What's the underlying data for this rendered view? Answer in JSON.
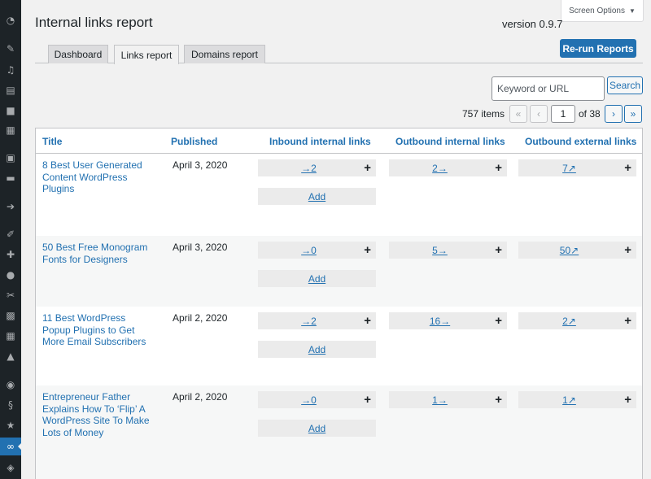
{
  "page": {
    "title": "Internal links report",
    "screen_options": "Screen Options",
    "version_label": "version",
    "version": "0.9.7",
    "rerun_label": "Re-run Reports"
  },
  "tabs": [
    {
      "label": "Dashboard",
      "active": false
    },
    {
      "label": "Links report",
      "active": true
    },
    {
      "label": "Domains report",
      "active": false
    }
  ],
  "search": {
    "placeholder": "Keyword or URL",
    "button": "Search"
  },
  "pagination": {
    "items": "757 items",
    "first": "«",
    "prev": "‹",
    "current": "1",
    "of": "of 38",
    "next": "›",
    "last": "»"
  },
  "table": {
    "columns": [
      "Title",
      "Published",
      "Inbound internal links",
      "Outbound internal links",
      "Outbound external links"
    ],
    "add_label": "Add",
    "plus": "+",
    "rows": [
      {
        "title": "8 Best User Generated Content WordPress Plugins",
        "date": "April 3, 2020",
        "inbound": "→2",
        "outbound_internal": "2→",
        "outbound_external": "7↗"
      },
      {
        "title": "50 Best Free Monogram Fonts for Designers",
        "date": "April 3, 2020",
        "inbound": "→0",
        "outbound_internal": "5→",
        "outbound_external": "50↗"
      },
      {
        "title": "11 Best WordPress Popup Plugins to Get More Email Subscribers",
        "date": "April 2, 2020",
        "inbound": "→2",
        "outbound_internal": "16→",
        "outbound_external": "2↗"
      },
      {
        "title": "Entrepreneur Father Explains How To ‘Flip’ A WordPress Site To Make Lots of Money",
        "date": "April 2, 2020",
        "inbound": "→0",
        "outbound_internal": "1→",
        "outbound_external": "1↗"
      }
    ]
  },
  "sidebar": {
    "icons": [
      "dashboard-icon",
      "pin-icon",
      "media-icon",
      "pages-icon",
      "comments-icon",
      "calendar-icon",
      "forms-icon",
      "folder-icon",
      "feedback-icon",
      "appearance-icon",
      "plugins-icon",
      "users-icon",
      "tools-icon",
      "settings-icon",
      "grid-icon",
      "analytics-icon",
      "seo-icon",
      "link-icon",
      "star-icon",
      "links-plugin-icon",
      "cache-icon"
    ]
  },
  "colors": {
    "accent": "#2271b1",
    "sidebar": "#1d2327",
    "background": "#f1f1f1"
  }
}
